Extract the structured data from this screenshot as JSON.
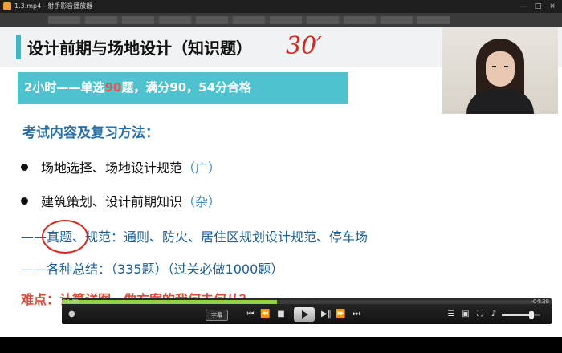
{
  "window": {
    "title": "1.3.mp4 - 射手影音播放器",
    "controls": [
      "—",
      "□",
      "×"
    ]
  },
  "slide": {
    "title": "设计前期与场地设计（知识题）",
    "handwritten_note": "30′",
    "exam_prefix": "2小时——单选",
    "exam_highlight": "90",
    "exam_suffix": "题，满分90，54分合格",
    "section_heading": "考试内容及复习方法：",
    "bullets": [
      {
        "text": "场地选择、场地设计规范",
        "paren": "（广）"
      },
      {
        "text": "建筑策划、设计前期知识",
        "paren": "（杂）"
      }
    ],
    "dash_lines": [
      "——真题、规范：通则、防火、居住区规划设计规范、停车场",
      "——各种总结：（335题）（过关必做1000题）"
    ],
    "difficulty": "难点：计算详图，做方案的我何去何从？"
  },
  "player": {
    "elapsed": "03:39",
    "remaining": "-04:39",
    "progress_fraction": 0.44,
    "subtitle_label": "字幕",
    "volume_fraction": 0.78,
    "colors": {
      "progress": "#8ed43a",
      "accent": "#4ec3cf"
    },
    "icons": [
      "user-icon",
      "subtitle-icon",
      "skip-start-icon",
      "rewind-icon",
      "stop-icon",
      "play-icon",
      "frame-forward-icon",
      "fast-forward-icon",
      "skip-end-icon",
      "playlist-icon",
      "screenshot-icon",
      "fullscreen-icon",
      "settings-icon",
      "volume-icon"
    ]
  }
}
